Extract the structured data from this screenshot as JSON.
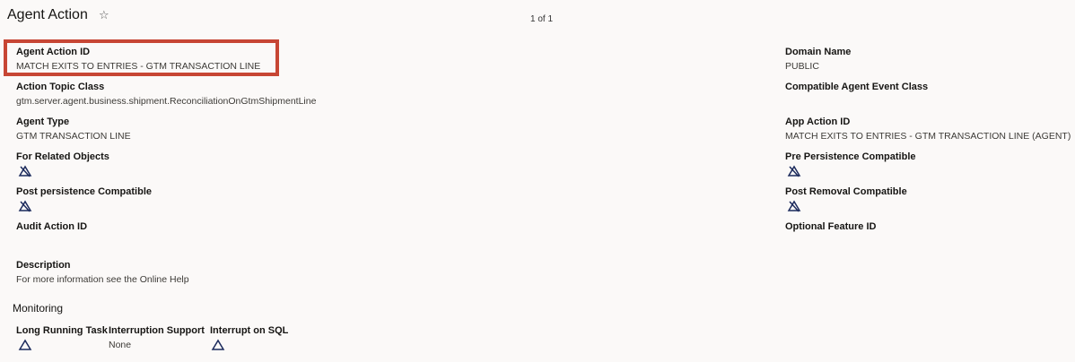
{
  "header": {
    "title": "Agent Action",
    "pager": "1 of 1"
  },
  "fields": {
    "agent_action_id": {
      "label": "Agent Action ID",
      "value": "MATCH EXITS TO ENTRIES - GTM TRANSACTION LINE"
    },
    "domain_name": {
      "label": "Domain Name",
      "value": "PUBLIC"
    },
    "action_topic_class": {
      "label": "Action Topic Class",
      "value": "gtm.server.agent.business.shipment.ReconciliationOnGtmShipmentLine"
    },
    "compatible_agent_event_class": {
      "label": "Compatible Agent Event Class",
      "value": ""
    },
    "agent_type": {
      "label": "Agent Type",
      "value": "GTM TRANSACTION LINE"
    },
    "app_action_id": {
      "label": "App Action ID",
      "value": "MATCH EXITS TO ENTRIES - GTM TRANSACTION LINE (AGENT)"
    },
    "for_related_objects": {
      "label": "For Related Objects",
      "icon": "unchecked-icon"
    },
    "pre_persistence_compatible": {
      "label": "Pre Persistence Compatible",
      "icon": "unchecked-icon"
    },
    "post_persistence_compatible": {
      "label": "Post persistence Compatible",
      "icon": "unchecked-icon"
    },
    "post_removal_compatible": {
      "label": "Post Removal Compatible",
      "icon": "unchecked-icon"
    },
    "audit_action_id": {
      "label": "Audit Action ID",
      "value": ""
    },
    "optional_feature_id": {
      "label": "Optional Feature ID",
      "value": ""
    },
    "description": {
      "label": "Description",
      "value": "For more information see the Online Help"
    }
  },
  "monitoring": {
    "title": "Monitoring",
    "long_running_task": {
      "label": "Long Running Task",
      "icon": "triangle-icon"
    },
    "interruption_support": {
      "label": "Interruption Support",
      "value": "None"
    },
    "interrupt_on_sql": {
      "label": "Interrupt on SQL",
      "icon": "triangle-icon"
    }
  },
  "colors": {
    "highlight": "#c74634",
    "icon": "#1b2a5c",
    "background": "#fbf9f8"
  }
}
